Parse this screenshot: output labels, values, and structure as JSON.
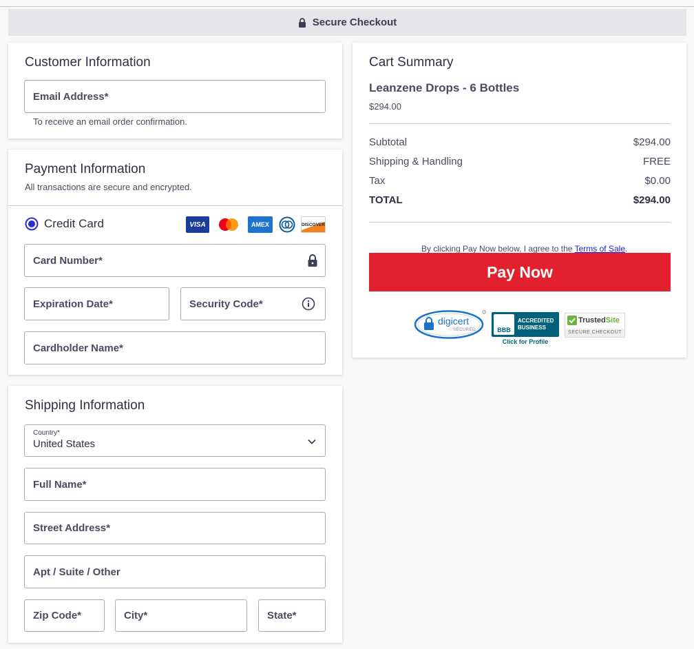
{
  "header": {
    "title": "Secure Checkout"
  },
  "customer": {
    "title": "Customer Information",
    "email_label": "Email Address*",
    "email_hint": "To receive an email order confirmation."
  },
  "payment": {
    "title": "Payment Information",
    "subtitle": "All transactions are secure and encrypted.",
    "method_label": "Credit Card",
    "card_brands": [
      "VISA",
      "mastercard",
      "AMEX",
      "diners",
      "DISCOVER"
    ],
    "card_number_label": "Card Number*",
    "expiration_label": "Expiration Date*",
    "security_code_label": "Security Code*",
    "cardholder_label": "Cardholder Name*"
  },
  "shipping": {
    "title": "Shipping Information",
    "country_label": "Country*",
    "country_value": "United States",
    "full_name_label": "Full Name*",
    "street_label": "Street Address*",
    "apt_label": "Apt / Suite / Other",
    "zip_label": "Zip Code*",
    "city_label": "City*",
    "state_label": "State*"
  },
  "cart": {
    "title": "Cart Summary",
    "product_name": "Leanzene Drops - 6 Bottles",
    "product_price": "$294.00",
    "rows": [
      {
        "label": "Subtotal",
        "value": "$294.00"
      },
      {
        "label": "Shipping & Handling",
        "value": "FREE"
      },
      {
        "label": "Tax",
        "value": "$0.00"
      }
    ],
    "total_label": "TOTAL",
    "total_value": "$294.00",
    "terms_prefix": "By clicking Pay Now below, I agree to the ",
    "terms_link": "Terms of Sale",
    "terms_suffix": ".",
    "pay_button": "Pay Now"
  },
  "badges": {
    "digicert": "digicert",
    "digicert_sub": "SECURED",
    "bbb_logo": "BBB",
    "bbb_line1": "ACCREDITED",
    "bbb_line2": "BUSINESS",
    "bbb_profile": "Click for Profile",
    "trusted_a": "Trusted",
    "trusted_b": "Site",
    "trusted_sub": "SECURE CHECKOUT"
  },
  "colors": {
    "accent_red": "#e3212e",
    "radio_blue": "#2b2bd8",
    "text_dark": "#2e2f45",
    "link_blue": "#1a1acf"
  }
}
